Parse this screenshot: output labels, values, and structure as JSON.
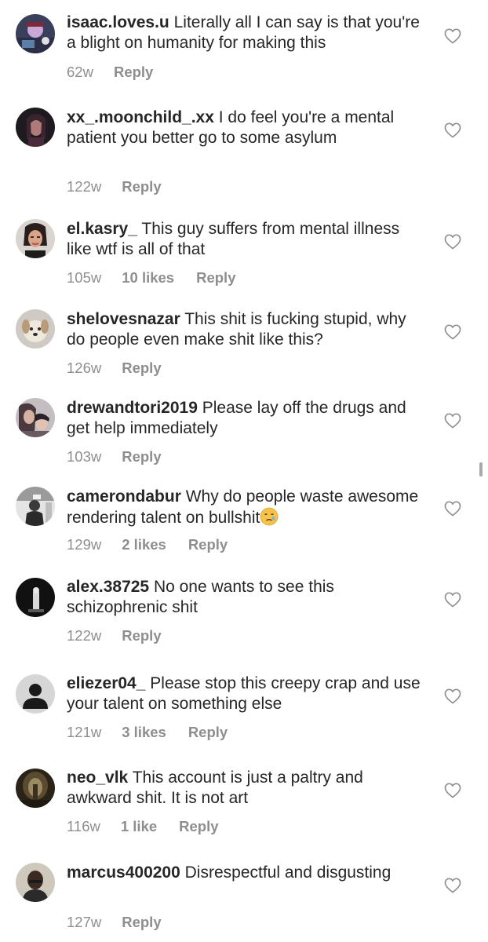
{
  "comments": [
    {
      "username": "isaac.loves.u",
      "text": "Literally all I can say is that you're a blight on humanity for making this",
      "time": "62w",
      "likes": "",
      "reply": "Reply",
      "avatar": "avatar-dark-cartoon"
    },
    {
      "username": "xx_.moonchild_.xx",
      "text": "I do feel you're a mental patient you better go to some asylum",
      "time": "122w",
      "likes": "",
      "reply": "Reply",
      "avatar": "avatar-dark-portrait"
    },
    {
      "username": "el.kasry_",
      "text": "This guy suffers from mental illness like wtf is all of that",
      "time": "105w",
      "likes": "10 likes",
      "reply": "Reply",
      "avatar": "avatar-woman-portrait"
    },
    {
      "username": "shelovesnazar",
      "text": "This shit is fucking stupid, why do people even make shit like this?",
      "time": "126w",
      "likes": "",
      "reply": "Reply",
      "avatar": "avatar-dog"
    },
    {
      "username": "drewandtori2019",
      "text": "Please lay off the drugs and get help immediately",
      "time": "103w",
      "likes": "",
      "reply": "Reply",
      "avatar": "avatar-couple"
    },
    {
      "username": "camerondabur",
      "text": "Why do people waste awesome rendering talent on bullshit",
      "emoji": "sad-face-emoji",
      "time": "129w",
      "likes": "2 likes",
      "reply": "Reply",
      "avatar": "avatar-grey-photo"
    },
    {
      "username": "alex.38725",
      "text": "No one wants to see this schizophrenic shit",
      "time": "122w",
      "likes": "",
      "reply": "Reply",
      "avatar": "avatar-dark-figure"
    },
    {
      "username": "eliezer04_",
      "text": "Please stop this creepy crap and use your talent on something else",
      "time": "121w",
      "likes": "3 likes",
      "reply": "Reply",
      "avatar": "default-avatar-icon"
    },
    {
      "username": "neo_vlk",
      "text": "This account is just a paltry and awkward shit. It is not art",
      "time": "116w",
      "likes": "1 like",
      "reply": "Reply",
      "avatar": "avatar-cave-photo"
    },
    {
      "username": "marcus400200",
      "text": "Disrespectful and disgusting",
      "time": "127w",
      "likes": "",
      "reply": "Reply",
      "avatar": "avatar-man-portrait"
    }
  ],
  "colors": {
    "text": "#262626",
    "meta": "#8e8e8e",
    "heart_outline": "#8e8e8e",
    "background": "#ffffff"
  },
  "icons": {
    "like": "heart-outline-icon"
  }
}
